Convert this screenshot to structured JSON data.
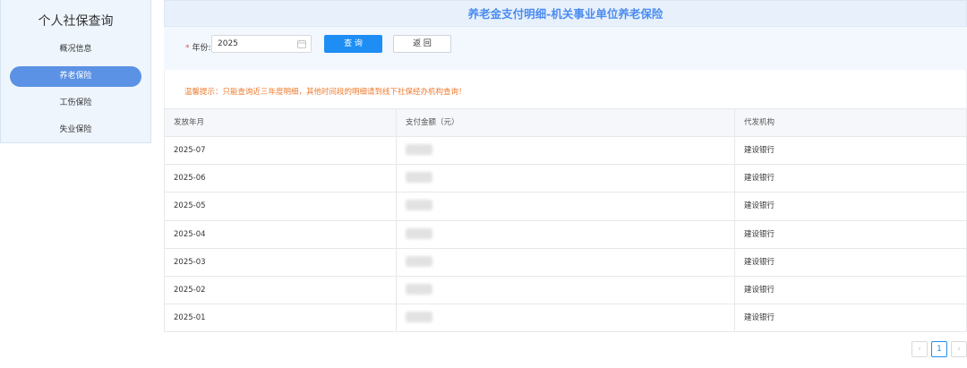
{
  "sidebar": {
    "title": "个人社保查询",
    "items": [
      {
        "label": "概况信息",
        "active": false
      },
      {
        "label": "养老保险",
        "active": true
      },
      {
        "label": "工伤保险",
        "active": false
      },
      {
        "label": "失业保险",
        "active": false
      }
    ]
  },
  "header": {
    "title": "养老金支付明细-机关事业单位养老保险"
  },
  "filter": {
    "year_label": "年份:",
    "required_mark": "*",
    "year_value": "2025",
    "query_label": "查 询",
    "back_label": "返 回"
  },
  "notice": "温馨提示：只能查询近三年度明细，其他时间段的明细请到线下社保经办机构查询！",
  "table": {
    "columns": [
      "发放年月",
      "支付金额（元）",
      "代发机构"
    ],
    "rows": [
      {
        "month": "2025-07",
        "amount": "",
        "bank": "建设银行"
      },
      {
        "month": "2025-06",
        "amount": "",
        "bank": "建设银行"
      },
      {
        "month": "2025-05",
        "amount": "",
        "bank": "建设银行"
      },
      {
        "month": "2025-04",
        "amount": "",
        "bank": "建设银行"
      },
      {
        "month": "2025-03",
        "amount": "",
        "bank": "建设银行"
      },
      {
        "month": "2025-02",
        "amount": "",
        "bank": "建设银行"
      },
      {
        "month": "2025-01",
        "amount": "",
        "bank": "建设银行"
      }
    ]
  },
  "pagination": {
    "prev": "‹",
    "current": "1",
    "next": "›"
  },
  "colors": {
    "accent": "#1e8ef5",
    "sidebar_active": "#5b92e5",
    "notice": "#ee7a2e",
    "title": "#4b8bf0"
  }
}
